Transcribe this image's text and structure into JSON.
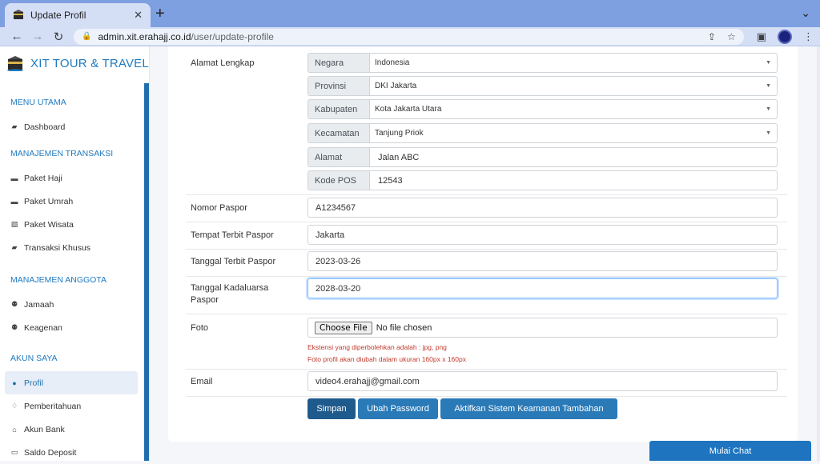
{
  "browser": {
    "tab_title": "Update Profil",
    "tab_close": "✕",
    "new_tab": "+",
    "url_host": "admin.xit.erahajj.co.id",
    "url_path": "/user/update-profile"
  },
  "sidebar": {
    "brand": "XIT TOUR & TRAVEL",
    "sections": [
      {
        "title": "MENU UTAMA",
        "items": [
          {
            "label": "Dashboard",
            "icon": "book-icon"
          }
        ]
      },
      {
        "title": "MANAJEMEN TRANSAKSI",
        "items": [
          {
            "label": "Paket Haji",
            "icon": "briefcase-icon"
          },
          {
            "label": "Paket Umrah",
            "icon": "briefcase-icon"
          },
          {
            "label": "Paket Wisata",
            "icon": "image-icon"
          },
          {
            "label": "Transaksi Khusus",
            "icon": "book-icon"
          }
        ]
      },
      {
        "title": "MANAJEMEN ANGGOTA",
        "items": [
          {
            "label": "Jamaah",
            "icon": "users-icon"
          },
          {
            "label": "Keagenan",
            "icon": "users-icon"
          }
        ]
      },
      {
        "title": "AKUN SAYA",
        "items": [
          {
            "label": "Profil",
            "icon": "user-icon",
            "active": true
          },
          {
            "label": "Pemberitahuan",
            "icon": "bell-icon"
          },
          {
            "label": "Akun Bank",
            "icon": "bank-icon"
          },
          {
            "label": "Saldo Deposit",
            "icon": "money-icon"
          }
        ]
      }
    ]
  },
  "form": {
    "address_label": "Alamat Lengkap",
    "address": {
      "country_label": "Negara",
      "country_value": "Indonesia",
      "province_label": "Provinsi",
      "province_value": "DKI Jakarta",
      "regency_label": "Kabupaten",
      "regency_value": "Kota Jakarta Utara",
      "district_label": "Kecamatan",
      "district_value": "Tanjung Priok",
      "street_label": "Alamat",
      "street_value": "Jalan ABC",
      "postal_label": "Kode POS",
      "postal_value": "12543"
    },
    "passport_no_label": "Nomor Paspor",
    "passport_no_value": "A1234567",
    "passport_place_label": "Tempat Terbit Paspor",
    "passport_place_value": "Jakarta",
    "passport_issue_label": "Tanggal Terbit Paspor",
    "passport_issue_value": "2023-03-26",
    "passport_expiry_label": "Tanggal Kadaluarsa Paspor",
    "passport_expiry_value": "2028-03-20",
    "photo_label": "Foto",
    "choose_file": "Choose File",
    "no_file": "No file chosen",
    "hint1": "Ekstensi yang diperbolehkan adalah : jpg, png",
    "hint2": "Foto profil akan diubah dalam ukuran 160px x 160px",
    "email_label": "Email",
    "email_value": "video4.erahajj@gmail.com",
    "save_button": "Simpan",
    "change_password_button": "Ubah Password",
    "security_button": "Aktifkan Sistem Keamanan Tambahan"
  },
  "chat": {
    "label": "Mulai Chat"
  },
  "colors": {
    "primary": "#1f5a8c",
    "info": "#2a7ab8",
    "brand": "#1f7ac0"
  }
}
